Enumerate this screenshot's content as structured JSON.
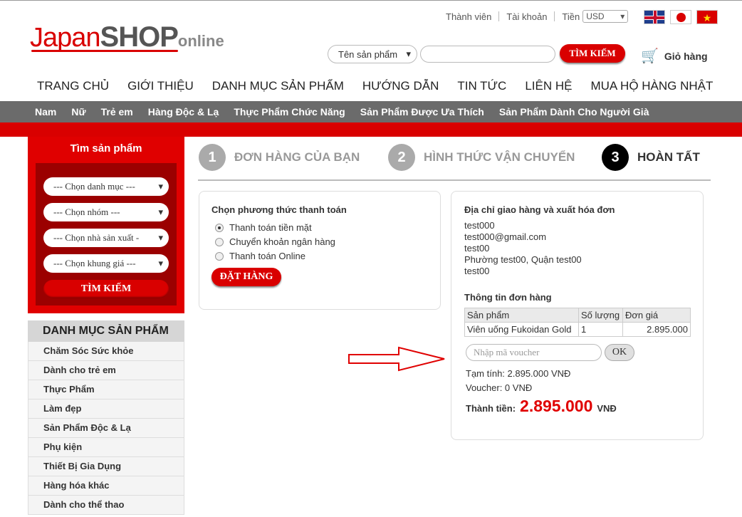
{
  "logo": {
    "part1": "Japan",
    "part2": "SHOP",
    "part3": "online"
  },
  "toplinks": {
    "member": "Thành viên",
    "account": "Tài khoản",
    "currency_label": "Tiền",
    "currency_value": "USD"
  },
  "search": {
    "category_placeholder": "Tên sản phẩm",
    "button": "TÌM KIẾM"
  },
  "cart": {
    "label": "Giỏ hàng"
  },
  "mainnav": [
    "TRANG CHỦ",
    "GIỚI THIỆU",
    "DANH MỤC SẢN PHẨM",
    "HƯỚNG DẪN",
    "TIN TỨC",
    "LIÊN HỆ",
    "MUA HỘ HÀNG NHẬT"
  ],
  "subnav": [
    "Nam",
    "Nữ",
    "Trẻ em",
    "Hàng Độc & Lạ",
    "Thực Phẩm Chức Năng",
    "Sản Phẩm Được Ưa Thích",
    "Sản Phẩm Dành Cho Người Già"
  ],
  "sidebar_search": {
    "title": "Tìm sản phẩm",
    "selects": [
      "--- Chọn danh mục ---",
      "--- Chọn nhóm ---",
      "--- Chọn nhà sản xuất -",
      "--- Chọn khung giá ---"
    ],
    "button": "TÌM KIẾM"
  },
  "categories": {
    "title": "DANH MỤC SẢN PHẨM",
    "items": [
      "Chăm Sóc Sức khỏe",
      "Dành cho trẻ em",
      "Thực Phẩm",
      "Làm đẹp",
      "Sản Phẩm Độc & Lạ",
      "Phụ kiện",
      "Thiết Bị Gia Dụng",
      "Hàng hóa khác",
      "Dành cho thể thao"
    ]
  },
  "steps": [
    {
      "num": "1",
      "label": "ĐƠN HÀNG CỦA BẠN"
    },
    {
      "num": "2",
      "label": "HÌNH THỨC VẬN CHUYỂN"
    },
    {
      "num": "3",
      "label": "HOÀN TẤT"
    }
  ],
  "payment": {
    "title": "Chọn phương thức thanh toán",
    "options": [
      "Thanh toán tiền mặt",
      "Chuyển khoản ngân hàng",
      "Thanh toán Online"
    ],
    "button": "ĐẶT HÀNG"
  },
  "shipping": {
    "title": "Địa chỉ giao hàng và xuất hóa đơn",
    "lines": [
      "test000",
      "test000@gmail.com",
      "test00",
      "Phường test00, Quận test00",
      "test00"
    ]
  },
  "order": {
    "title": "Thông tin đơn hàng",
    "headers": [
      "Sản phẩm",
      "Số lượng",
      "Đơn giá"
    ],
    "row": [
      "Viên uống Fukoidan Gold",
      "1",
      "2.895.000"
    ],
    "voucher_placeholder": "Nhập mã voucher",
    "ok": "OK",
    "subtotal": "Tạm tính: 2.895.000 VNĐ",
    "voucher": "Voucher: 0 VNĐ",
    "total_label": "Thành tiền:",
    "total_amount": "2.895.000",
    "total_unit": "VNĐ"
  },
  "colors": {
    "brand_red": "#d90000",
    "nav_gray": "#6b6b6b"
  }
}
